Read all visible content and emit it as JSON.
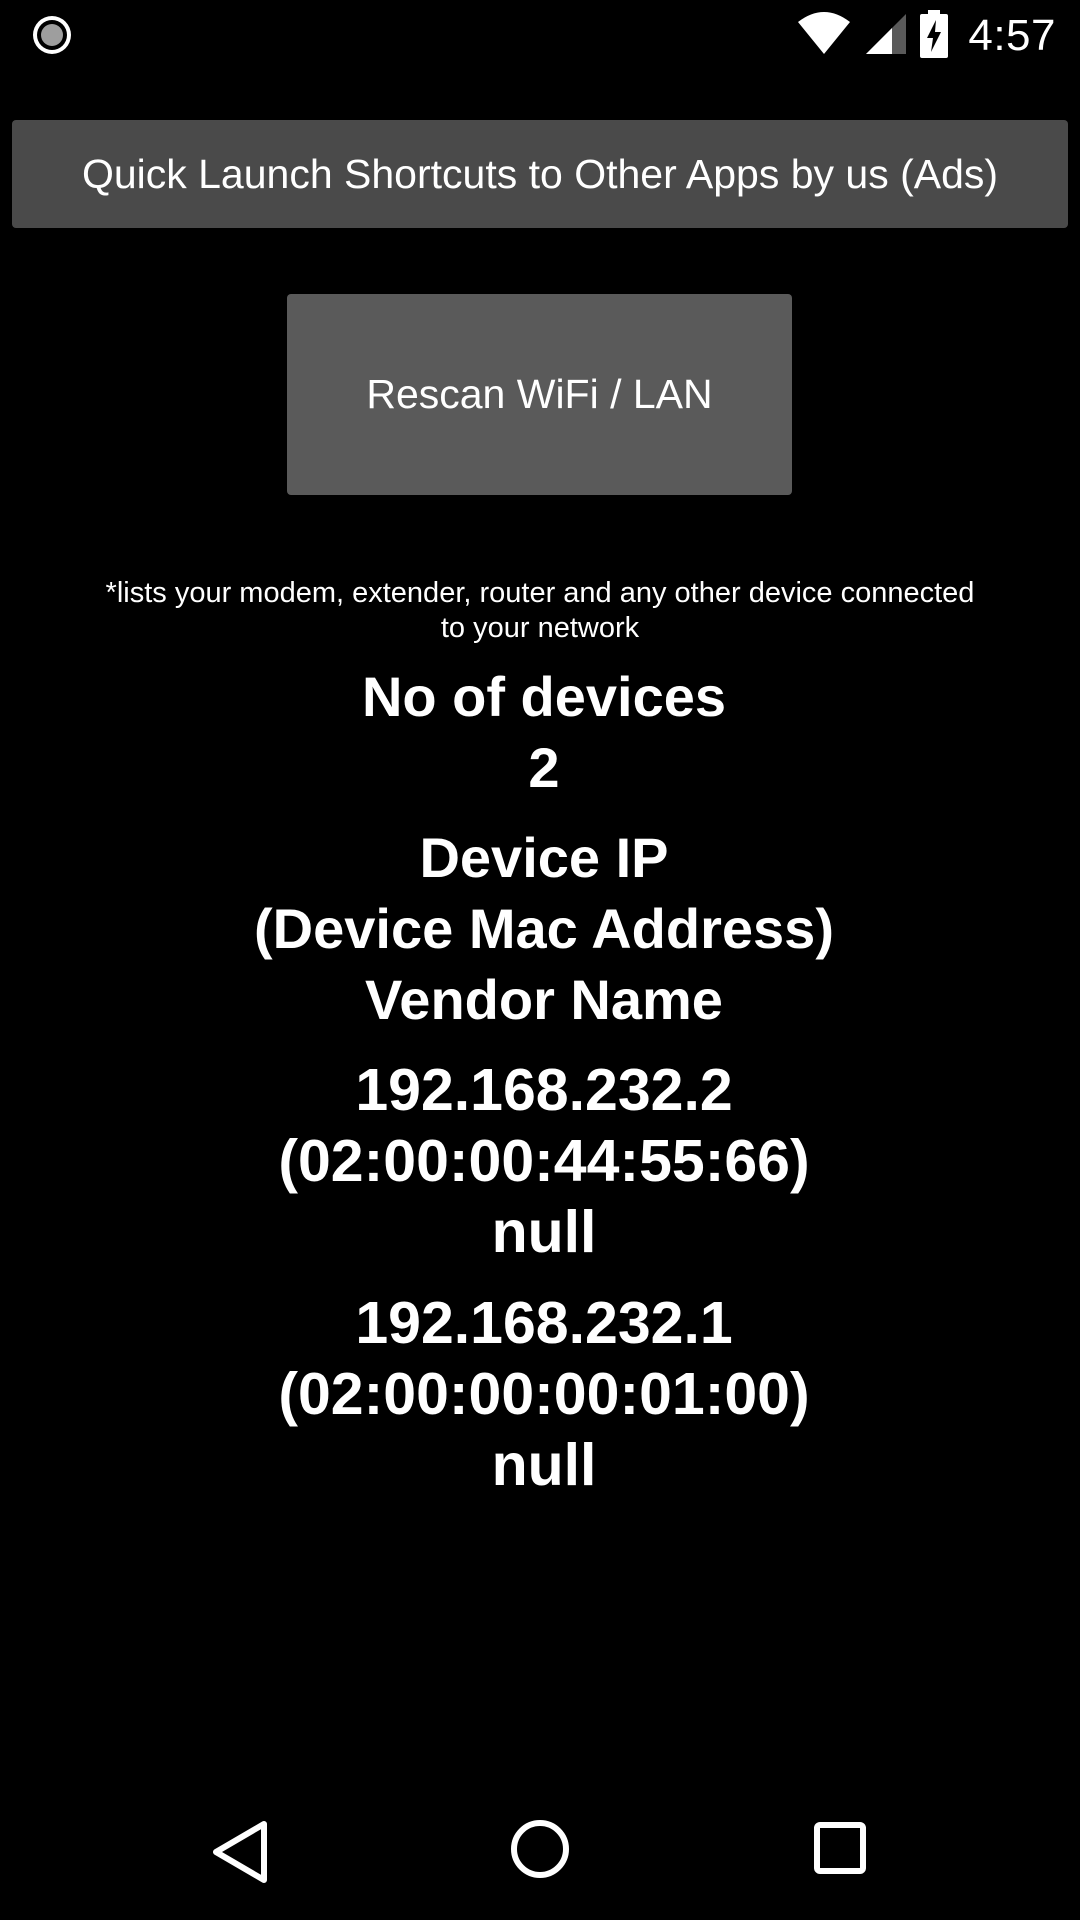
{
  "status_bar": {
    "left_icon": "record-icon",
    "wifi_icon": "wifi-icon",
    "signal_icon": "cell-signal-icon",
    "battery_icon": "battery-charging-icon",
    "time": "4:57"
  },
  "ads_button": {
    "label": "Quick Launch Shortcuts to Other Apps by us (Ads)"
  },
  "rescan_button": {
    "label": "Rescan WiFi / LAN"
  },
  "note": {
    "line1": "*lists your modem, extender, router and any other device connected",
    "line2": "to your network"
  },
  "device_count": {
    "label": "No of devices",
    "value": "2"
  },
  "list_header": {
    "ip": "Device IP",
    "mac": "(Device Mac Address)",
    "vendor": "Vendor Name"
  },
  "devices": [
    {
      "ip": "192.168.232.2",
      "mac": "(02:00:00:44:55:66)",
      "vendor": "null"
    },
    {
      "ip": "192.168.232.1",
      "mac": "(02:00:00:00:01:00)",
      "vendor": "null"
    }
  ],
  "nav_bar": {
    "back_icon": "back-triangle-icon",
    "home_icon": "home-circle-icon",
    "recents_icon": "recents-square-icon"
  },
  "colors": {
    "background": "#000000",
    "ads_button_bg": "#4a4a4a",
    "rescan_button_bg": "#5a5a5a",
    "text": "#ffffff"
  }
}
